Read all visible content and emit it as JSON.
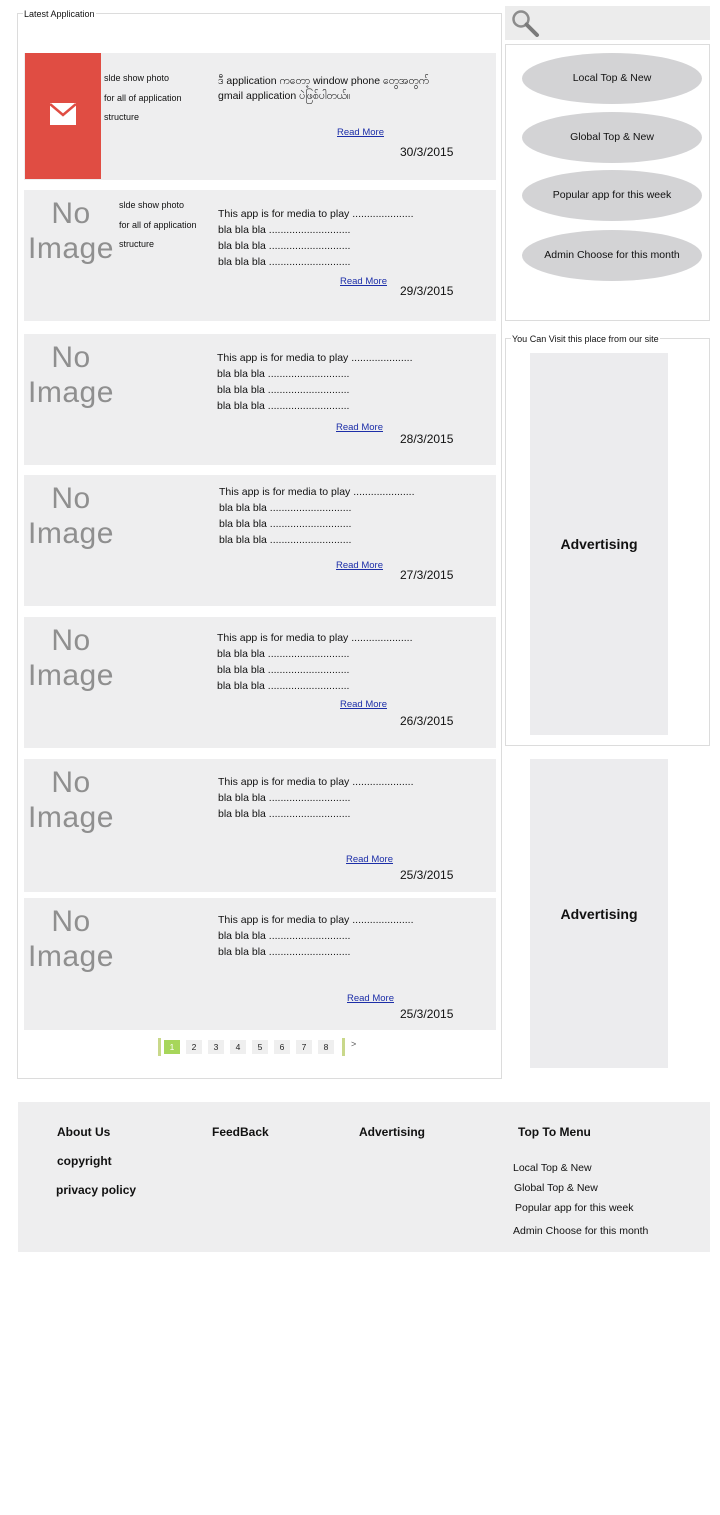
{
  "main": {
    "title": "Latest Application",
    "apps": [
      {
        "side_lines": [
          "slde show photo",
          "for all of application",
          "structure"
        ],
        "description": [
          "ဒီ application ကတော့ window phone တွေအတွက်",
          "gmail application ပဲဖြစ်ပါတယ်။"
        ],
        "read_more": "Read More",
        "date": "30/3/2015",
        "thumb": "mail-icon"
      },
      {
        "no_image": [
          "No",
          "Image"
        ],
        "side_lines": [
          "slde show photo",
          "for all of application",
          "structure"
        ],
        "description": [
          "This app is for media to play .....................",
          "bla bla bla ............................",
          "bla bla bla ............................",
          "bla bla bla ............................"
        ],
        "read_more": "Read More",
        "date": "29/3/2015"
      },
      {
        "no_image": [
          "No",
          "Image"
        ],
        "description": [
          "This app is for media to play .....................",
          "bla bla bla ............................",
          "bla bla bla ............................",
          "bla bla bla ............................"
        ],
        "read_more": "Read More",
        "date": "28/3/2015"
      },
      {
        "no_image": [
          "No",
          "Image"
        ],
        "description": [
          "This app is for media to play .....................",
          "bla bla bla ............................",
          "bla bla bla ............................",
          "bla bla bla ............................"
        ],
        "read_more": "Read More",
        "date": "27/3/2015"
      },
      {
        "no_image": [
          "No",
          "Image"
        ],
        "description": [
          "This app is for media to play .....................",
          "bla bla bla ............................",
          "bla bla bla ............................",
          "bla bla bla ............................"
        ],
        "read_more": "Read More",
        "date": "26/3/2015"
      },
      {
        "no_image": [
          "No",
          "Image"
        ],
        "description": [
          "This app is for media to play .....................",
          "bla bla bla ............................",
          "bla bla bla ............................"
        ],
        "read_more": "Read More",
        "date": "25/3/2015"
      },
      {
        "no_image": [
          "No",
          "Image"
        ],
        "description": [
          "This app is for media to play .....................",
          "bla bla bla ............................",
          "bla bla bla ............................"
        ],
        "read_more": "Read More",
        "date": "25/3/2015"
      }
    ],
    "pagination": {
      "pages": [
        "1",
        "2",
        "3",
        "4",
        "5",
        "6",
        "7",
        "8"
      ],
      "active": "1",
      "next": ">"
    }
  },
  "sidebar": {
    "search_icon": "search-icon",
    "menu": [
      "Local Top & New",
      "Global Top & New",
      "Popular app for this week",
      "Admin Choose for this month"
    ],
    "visit_title": "You Can Visit this place from our site",
    "ads": [
      "Advertising",
      "Advertising"
    ]
  },
  "footer": {
    "about": "About Us",
    "copyright": "copyright",
    "privacy": "privacy policy",
    "feedback": "FeedBack",
    "advertising": "Advertising",
    "top_menu_title": "Top To Menu",
    "top_menu": [
      "Local Top & New",
      "Global Top & New",
      "Popular app for this week",
      "Admin Choose for this month"
    ]
  },
  "colors": {
    "card_bg": "#eeeeef",
    "thumb_red": "#e04d43",
    "link": "#1c2ea8",
    "pill": "#d3d3d5",
    "page_active": "#a7d65a"
  }
}
